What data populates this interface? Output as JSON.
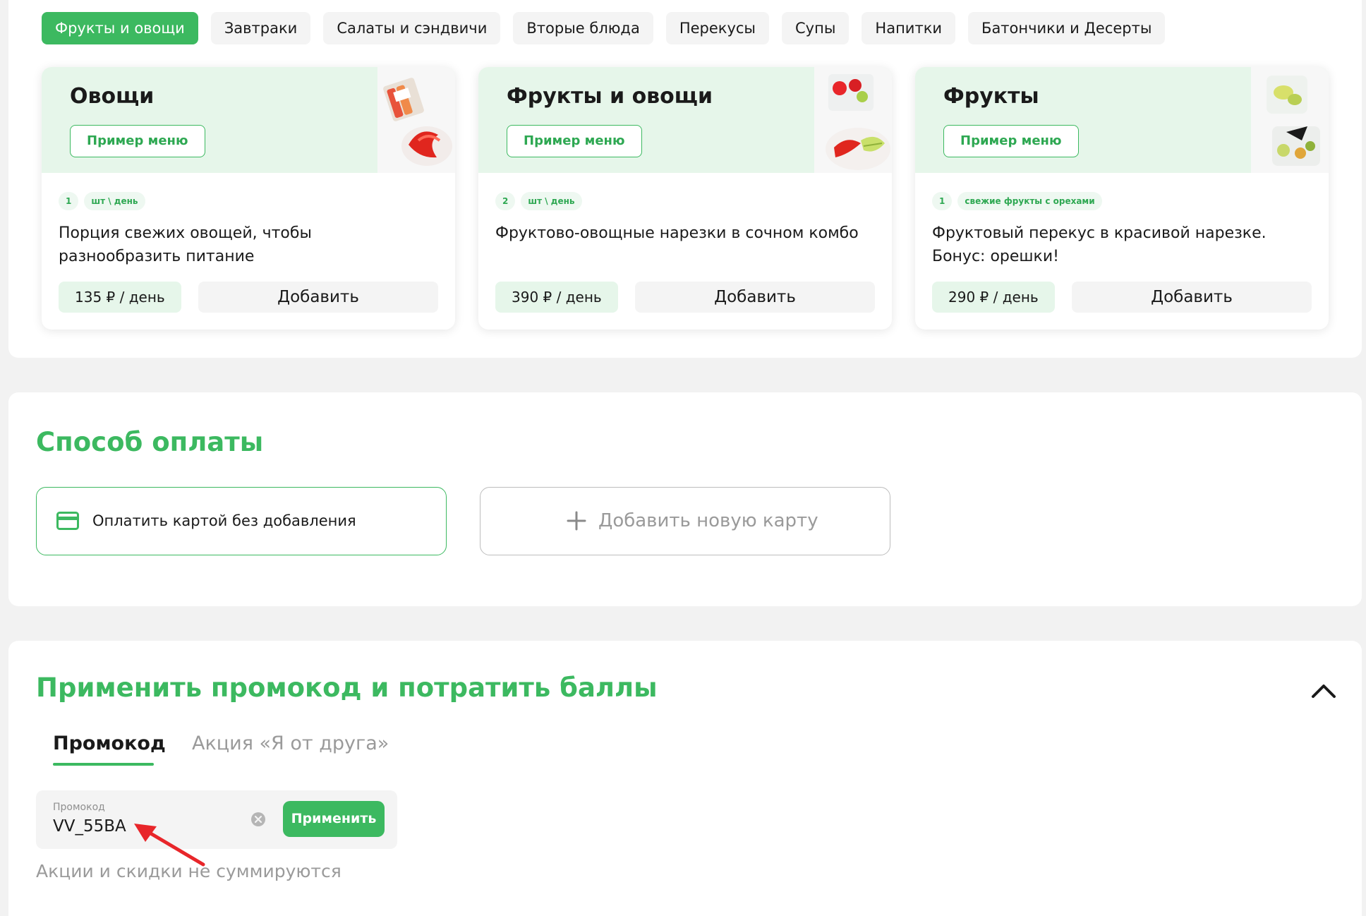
{
  "categories": [
    {
      "label": "Фрукты и овощи",
      "active": true
    },
    {
      "label": "Завтраки",
      "active": false
    },
    {
      "label": "Салаты и сэндвичи",
      "active": false
    },
    {
      "label": "Вторые блюда",
      "active": false
    },
    {
      "label": "Перекусы",
      "active": false
    },
    {
      "label": "Супы",
      "active": false
    },
    {
      "label": "Напитки",
      "active": false
    },
    {
      "label": "Батончики и Десерты",
      "active": false
    }
  ],
  "products": [
    {
      "title": "Овощи",
      "menu_button": "Пример меню",
      "tags": [
        "1",
        "шт \\ день"
      ],
      "description": "Порция свежих овощей, чтобы разнообразить питание",
      "price": "135 ₽ / день",
      "add_button": "Добавить"
    },
    {
      "title": "Фрукты и овощи",
      "menu_button": "Пример меню",
      "tags": [
        "2",
        "шт \\ день"
      ],
      "description": "Фруктово-овощные нарезки в сочном комбо",
      "price": "390 ₽ / день",
      "add_button": "Добавить"
    },
    {
      "title": "Фрукты",
      "menu_button": "Пример меню",
      "tags": [
        "1",
        "свежие фрукты с орехами"
      ],
      "description": "Фруктовый перекус в красивой нарезке. Бонус: орешки!",
      "price": "290 ₽ / день",
      "add_button": "Добавить"
    }
  ],
  "payment": {
    "title": "Способ оплаты",
    "card_option": "Оплатить картой без добавления",
    "card_icon": "credit-card-icon",
    "new_card_option": "Добавить новую карту",
    "new_card_icon": "plus-icon"
  },
  "promo": {
    "title": "Применить промокод и потратить баллы",
    "collapse_icon": "chevron-up-icon",
    "tabs": [
      {
        "label": "Промокод",
        "active": true
      },
      {
        "label": "Акция «Я от друга»",
        "active": false
      }
    ],
    "field_caption": "Промокод",
    "field_value": "VV_55BA",
    "clear_icon": "clear-icon",
    "apply_button": "Применить",
    "note": "Акции и скидки не суммируются"
  },
  "colors": {
    "accent": "#3cb960",
    "accent_light": "#e6f6ea",
    "annotation_arrow": "#e8262a"
  }
}
